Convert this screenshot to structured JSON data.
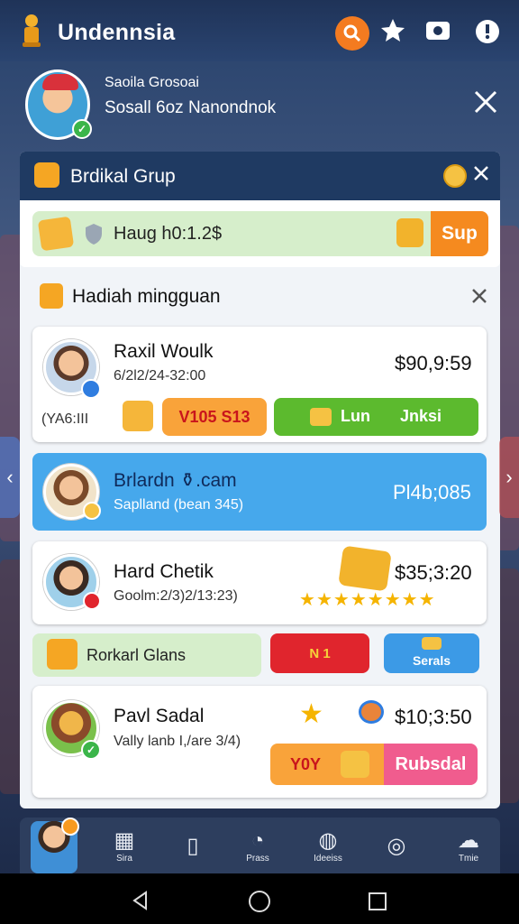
{
  "app": {
    "title": "Undennsia"
  },
  "profile": {
    "line1": "Saoila Grosoai",
    "line2": "Sosall 6oz Nanondnok"
  },
  "group": {
    "title": "Brdikal Grup",
    "input_text": "Haug h0:1.2$",
    "action_label": "Sup"
  },
  "weekly": {
    "title": "Hadiah mingguan",
    "entries": [
      {
        "name": "Raxil Woulk",
        "sub": "6/2l2/24-32:00",
        "amount": "$90,9:59",
        "tag": "(YA6:III",
        "btn1": "V105 S13",
        "btn2_a": "Lun",
        "btn2_b": "Jnksi"
      },
      {
        "name": "Brlardn ⚱.cam",
        "sub": "Saplland (bean 345)",
        "amount": "Pl4b;085"
      },
      {
        "name": "Hard Chetik",
        "sub": "Goolm:2/3)2/13:23)",
        "amount": "$35;3:20"
      },
      {
        "name": "Pavl Sadal",
        "sub": "Vally lanb I,/are 3/4)",
        "amount": "$10;3:50",
        "btn1": "Y0Y",
        "btn2": "Rubsdal"
      }
    ],
    "promo": {
      "label": "Rorkarl Glans",
      "badge": "N 1",
      "side_label": "Serals"
    }
  },
  "nav": {
    "items": [
      "Sira",
      "",
      "Prass",
      "Ideeiss",
      "",
      "Tmie"
    ]
  },
  "colors": {
    "orange": "#f79a1f",
    "green": "#5cba2e",
    "blue": "#3c9ae6",
    "red": "#e0252d",
    "pink": "#f05c8e"
  }
}
